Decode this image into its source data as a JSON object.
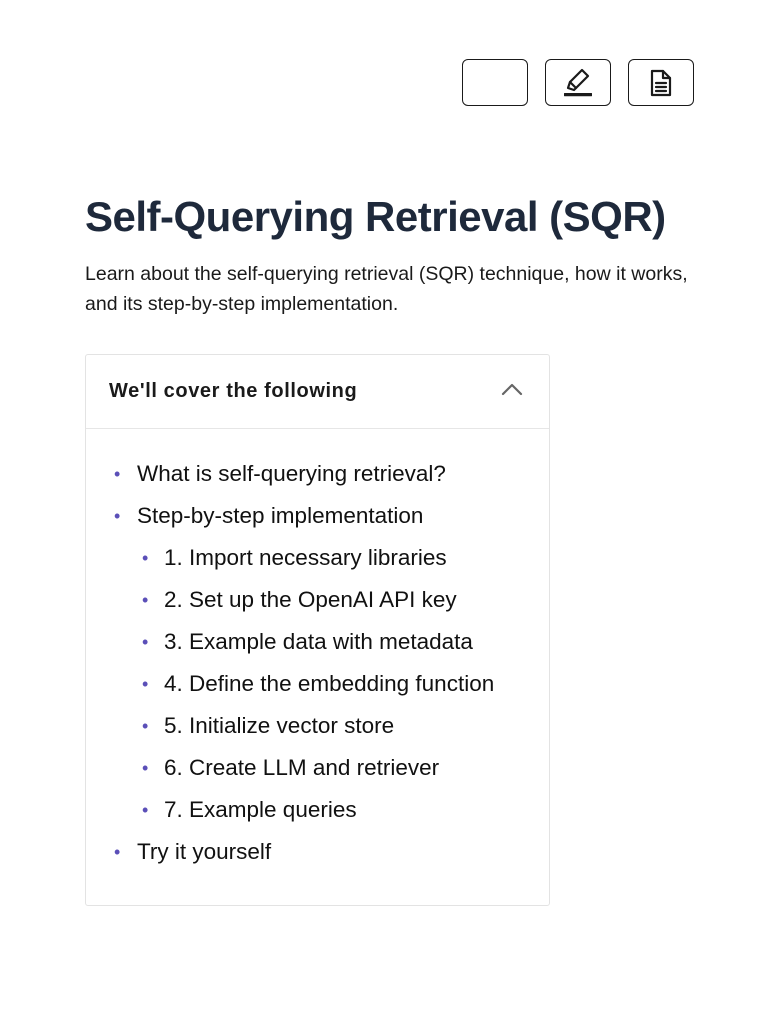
{
  "toolbar": {
    "buttons": [
      {
        "name": "blank-button",
        "icon": ""
      },
      {
        "name": "highlighter-button",
        "icon": "highlighter-icon"
      },
      {
        "name": "document-button",
        "icon": "document-icon"
      }
    ]
  },
  "page": {
    "title": "Self-Querying Retrieval (SQR)",
    "description": "Learn about the self-querying retrieval (SQR) technique, how it works, and its step-by-step implementation."
  },
  "toc": {
    "header": "We'll cover the following",
    "expanded": true,
    "collapse_icon": "chevron-up-icon",
    "bullet_color": "#5b4fb8",
    "items": [
      {
        "label": "What is self-querying retrieval?",
        "level": 1
      },
      {
        "label": "Step-by-step implementation",
        "level": 1
      },
      {
        "label": "1. Import necessary libraries",
        "level": 2
      },
      {
        "label": "2. Set up the OpenAI API key",
        "level": 2
      },
      {
        "label": "3. Example data with metadata",
        "level": 2
      },
      {
        "label": "4. Define the embedding function",
        "level": 2
      },
      {
        "label": "5. Initialize vector store",
        "level": 2
      },
      {
        "label": "6. Create LLM and retriever",
        "level": 2
      },
      {
        "label": "7. Example queries",
        "level": 2
      },
      {
        "label": "Try it yourself",
        "level": 1
      }
    ]
  }
}
